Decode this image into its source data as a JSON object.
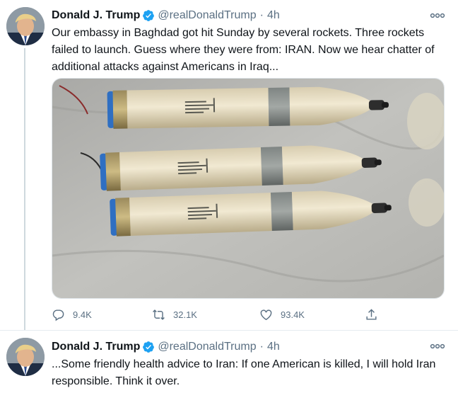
{
  "tweets": [
    {
      "author_name": "Donald J. Trump",
      "handle": "@realDonaldTrump",
      "separator": "·",
      "time": "4h",
      "text_lines": [
        "Our embassy in Baghdad got hit Sunday by several rockets. Three rockets",
        "failed to launch. Guess where they were from: IRAN. Now we hear chatter of",
        "additional attacks against Americans in Iraq..."
      ],
      "image_alt": "Three rockets lying on a concrete floor",
      "actions": {
        "replies": "9.4K",
        "retweets": "32.1K",
        "likes": "93.4K"
      },
      "icons": [
        "verified-badge",
        "more-icon",
        "reply-icon",
        "retweet-icon",
        "like-icon",
        "share-icon"
      ]
    },
    {
      "author_name": "Donald J. Trump",
      "handle": "@realDonaldTrump",
      "separator": "·",
      "time": "4h",
      "text_lines": [
        "...Some friendly health advice to Iran: If one American is killed, I will hold Iran",
        "responsible. Think it over."
      ]
    }
  ],
  "colors": {
    "verified": "#1da1f2",
    "secondary_text": "#5b7083",
    "thread_line": "#cfd9de"
  }
}
